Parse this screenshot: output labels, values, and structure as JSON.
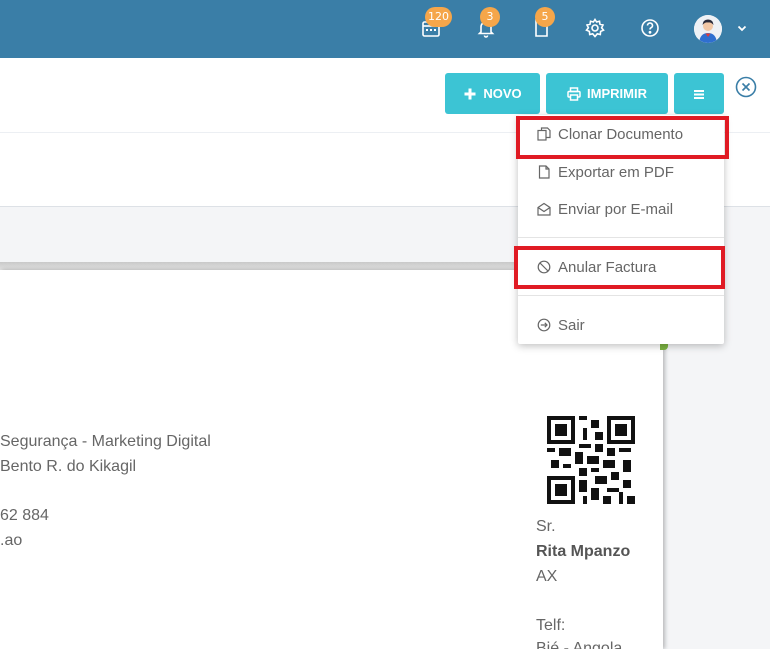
{
  "topbar": {
    "badges": {
      "calendar": "120",
      "notifications": "3",
      "documents": "5"
    },
    "icons": [
      "calendar-icon",
      "bell-icon",
      "document-icon",
      "gear-icon",
      "help-icon",
      "avatar",
      "chevron-down-icon"
    ]
  },
  "actions": {
    "novo_label": "NOVO",
    "imprimir_label": "IMPRIMIR"
  },
  "menu": {
    "items": [
      {
        "label": "Clonar Documento",
        "icon": "copy-icon"
      },
      {
        "label": "Exportar em PDF",
        "icon": "file-icon"
      },
      {
        "label": "Enviar por E-mail",
        "icon": "envelope-icon"
      },
      {
        "label": "Anular Factura",
        "icon": "ban-icon"
      },
      {
        "label": "Sair",
        "icon": "exit-icon"
      }
    ]
  },
  "document": {
    "company_lines": [
      "Segurança - Marketing Digital",
      "Bento R. do Kikagil",
      "62 884",
      ".ao"
    ],
    "customer": {
      "salutation": "Sr.",
      "name": "Rita Mpanzo",
      "code": "AX",
      "phone_label": "Telf:",
      "city": "Bié - Angola"
    }
  },
  "colors": {
    "topbar": "#3a7ea7",
    "button": "#3cc4d4",
    "badge": "#f5a64a",
    "highlight": "#e01b24"
  }
}
